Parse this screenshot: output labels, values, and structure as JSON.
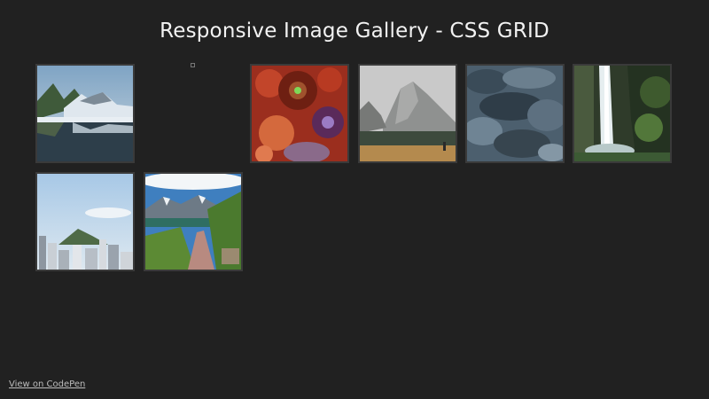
{
  "page": {
    "title": "Responsive Image Gallery - CSS GRID"
  },
  "gallery": {
    "images": [
      {
        "subject": "mountain lake reflection"
      },
      {
        "subject": "missing image"
      },
      {
        "subject": "red coral anemone"
      },
      {
        "subject": "foggy mountain with hiker"
      },
      {
        "subject": "rocky terrain"
      },
      {
        "subject": "waterfall in forest"
      },
      {
        "subject": "city skyline with hill"
      },
      {
        "subject": "mountain trail"
      }
    ]
  },
  "footer": {
    "codepen_link": "View on CodePen"
  },
  "colors": {
    "background": "#212121",
    "tile_border": "#3a3a3a",
    "title": "#f2f2f2",
    "link": "#bdbdbd"
  }
}
